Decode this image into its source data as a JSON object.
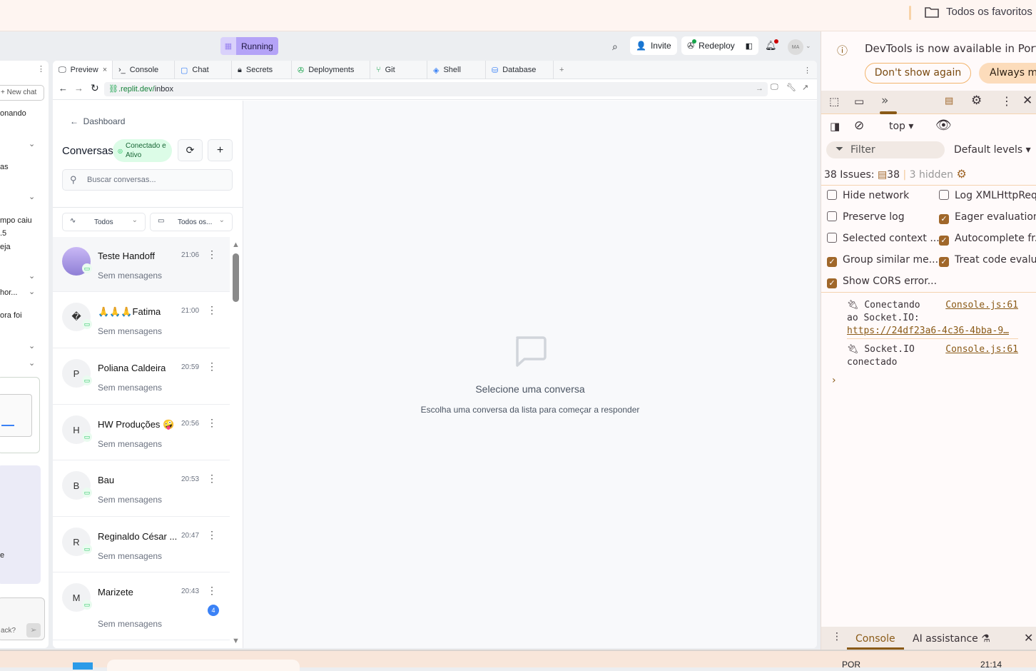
{
  "browser": {
    "bookmarks_folder": "Todos os favoritos"
  },
  "replit": {
    "status": "Running",
    "invite": "Invite",
    "redeploy": "Redeploy",
    "avatar_initials": "MA",
    "left_panel": {
      "new_chat": "+ New chat",
      "fragments": [
        "onando",
        "as",
        "mpo caiu",
        ".5",
        "eja",
        "hor...",
        "ora foi",
        "e",
        "ack?"
      ]
    },
    "tabs": [
      {
        "label": "Preview",
        "icon": "monitor-icon"
      },
      {
        "label": "Console",
        "icon": "terminal-icon"
      },
      {
        "label": "Chat",
        "icon": "chat-icon"
      },
      {
        "label": "Secrets",
        "icon": "lock-icon"
      },
      {
        "label": "Deployments",
        "icon": "deploy-icon"
      },
      {
        "label": "Git",
        "icon": "git-icon"
      },
      {
        "label": "Shell",
        "icon": "shell-icon"
      },
      {
        "label": "Database",
        "icon": "database-icon"
      }
    ],
    "url": {
      "domain": ".replit.dev/",
      "path": "inbox"
    }
  },
  "app": {
    "back_label": "Dashboard",
    "title": "Conversas",
    "status_badge": "Conectado e Ativo",
    "search_placeholder": "Buscar conversas...",
    "filter_status": "Todos",
    "filter_channel": "Todos os...",
    "conversations": [
      {
        "name": "Teste Handoff",
        "time": "21:06",
        "preview": "Sem mensagens",
        "initial": "",
        "selected": true
      },
      {
        "name": "🙏🙏🙏Fatima",
        "time": "21:00",
        "preview": "Sem mensagens",
        "initial": "�"
      },
      {
        "name": "Poliana Caldeira",
        "time": "20:59",
        "preview": "Sem mensagens",
        "initial": "P"
      },
      {
        "name": "HW Produções 🤪",
        "time": "20:56",
        "preview": "Sem mensagens",
        "initial": "H"
      },
      {
        "name": "Bau",
        "time": "20:53",
        "preview": "Sem mensagens",
        "initial": "B"
      },
      {
        "name": "Reginaldo César ...",
        "time": "20:47",
        "preview": "Sem mensagens",
        "initial": "R"
      },
      {
        "name": "Marizete",
        "time": "20:43",
        "preview": "Sem mensagens",
        "initial": "M",
        "unread": "4"
      }
    ],
    "empty_title": "Selecione uma conversa",
    "empty_subtitle": "Escolha uma conversa da lista para começar a responder"
  },
  "devtools": {
    "notice": "DevTools is now available in Portu",
    "dont_show": "Don't show again",
    "always": "Always ma",
    "context": "top",
    "filter_placeholder": "Filter",
    "levels": "Default levels",
    "issues_label": "38 Issues:",
    "issues_count": "38",
    "hidden": "3 hidden",
    "options": [
      {
        "label": "Hide network",
        "checked": false
      },
      {
        "label": "Log XMLHttpReq",
        "checked": false
      },
      {
        "label": "Preserve log",
        "checked": false
      },
      {
        "label": "Eager evaluation",
        "checked": true
      },
      {
        "label": "Selected context ...",
        "checked": false
      },
      {
        "label": "Autocomplete fr...",
        "checked": true
      },
      {
        "label": "Group similar me...",
        "checked": true
      },
      {
        "label": "Treat code evalua",
        "checked": true
      },
      {
        "label": "Show CORS error...",
        "checked": true
      }
    ],
    "logs": [
      {
        "line1": "Conectando",
        "line2": "ao Socket.IO:",
        "url": "https://24df23a6-4c36-4bba-9…",
        "source": "Console.js:61"
      },
      {
        "line1": "Socket.IO",
        "line2": "conectado",
        "source": "Console.js:61"
      }
    ],
    "bottom_tabs": [
      "Console",
      "AI assistance"
    ]
  },
  "taskbar": {
    "lang": "POR",
    "time": "21:14"
  },
  "colors": {
    "accent_running": "#b4a3f7",
    "devtools_accent": "#a0672a",
    "status_green": "#dcfce7",
    "unread_blue": "#3b82f6"
  }
}
